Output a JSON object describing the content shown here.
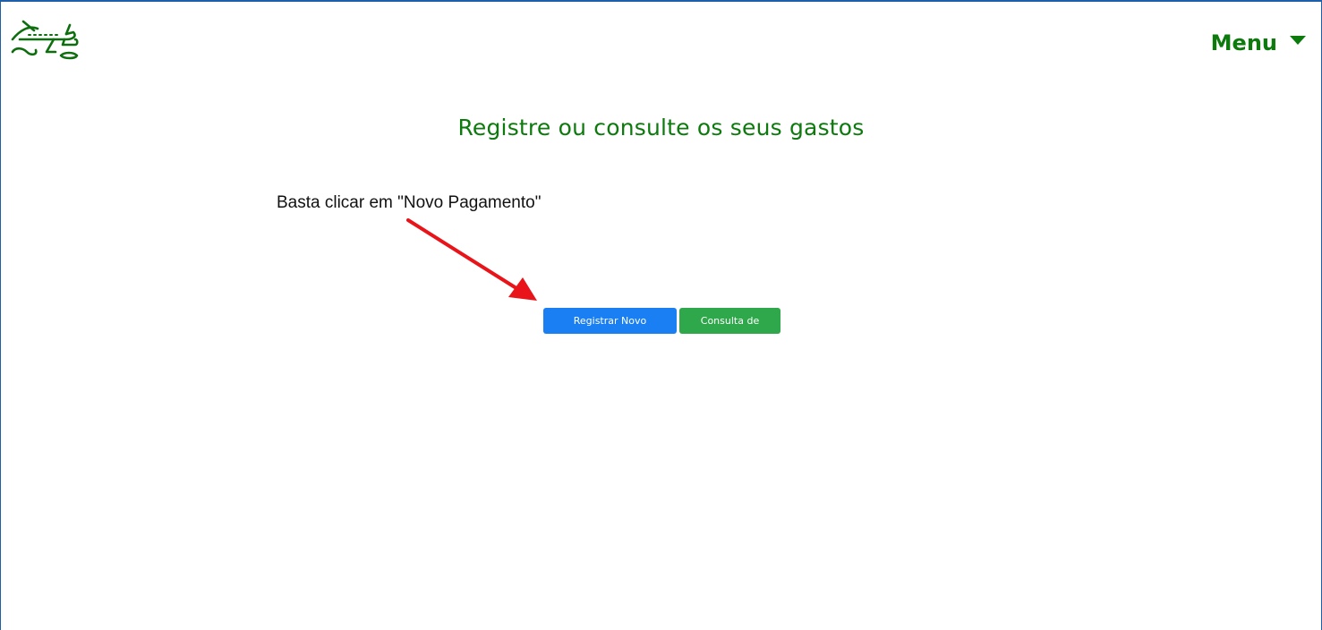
{
  "header": {
    "logo_icon": "airplane-logo-icon",
    "menu_label": "Menu",
    "menu_icon": "caret-down-icon",
    "brand_color": "#0d7a0d"
  },
  "main": {
    "title": "Registre ou consulte os seus gastos",
    "annotation": "Basta clicar em \"Novo Pagamento\"",
    "annotation_arrow_color": "#e8141a",
    "buttons": {
      "register_label": "Registrar Novo Pagamento",
      "register_color": "#1a7ff2",
      "expenses_label": "Consulta de Gastos",
      "expenses_color": "#2ea84a"
    }
  }
}
